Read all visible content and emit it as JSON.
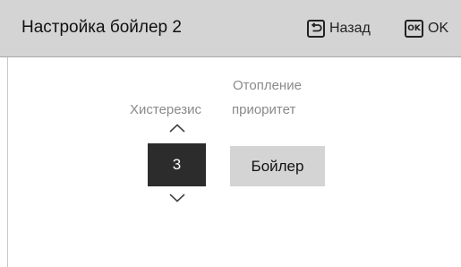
{
  "header": {
    "title": "Настройка бойлер 2",
    "back_label": "Назад",
    "ok_icon_text": "OK",
    "ok_label": "OK",
    "icons": {
      "back": "back-arrow-icon",
      "ok": "ok-icon"
    }
  },
  "settings": {
    "hysteresis": {
      "label": "Хистерезис",
      "value": "3",
      "icons": {
        "up": "chevron-up-icon",
        "down": "chevron-down-icon"
      }
    },
    "heating_priority": {
      "label_line1": "Отопление",
      "label_line2": "приоритет",
      "value": "Бойлер"
    }
  },
  "colors": {
    "header_bg": "#d4d4d4",
    "selected_value_bg": "#2c2c2c",
    "selected_value_text": "#ffffff",
    "option_bg": "#d4d4d4",
    "label_text": "#8a8a8a"
  }
}
